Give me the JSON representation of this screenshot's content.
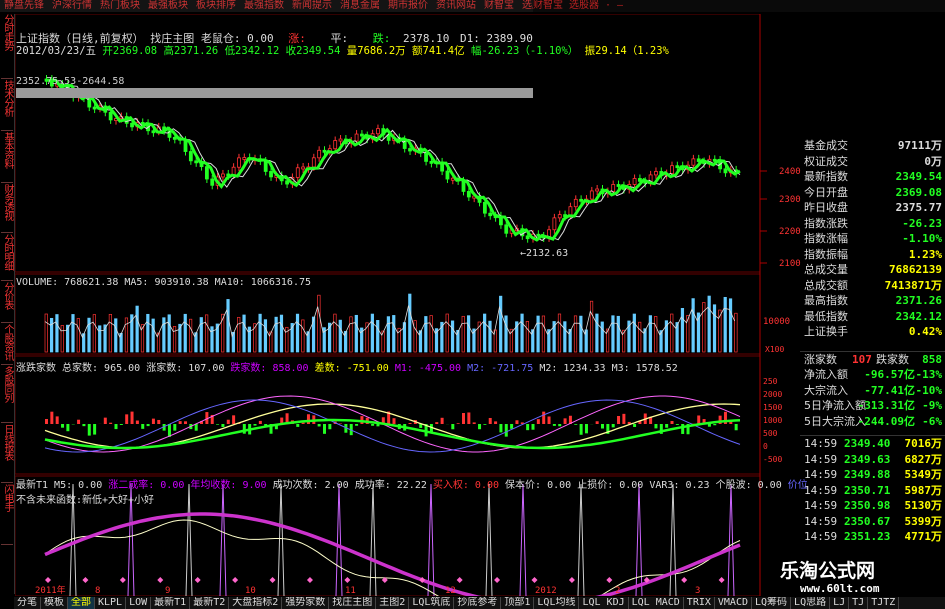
{
  "top_menu": [
    "静盘先锋",
    "沪深行情",
    "热门板块",
    "最强板块",
    "板块排序",
    "最强指数",
    "新闻提示",
    "消息金属",
    "期市报价",
    "资讯网站",
    "财智宝",
    "选股器"
  ],
  "top_menu_tail": [
    "财智宝",
    "选股器",
    "·",
    "—"
  ],
  "left_nav": [
    "分时走势",
    "技术分析",
    "基本资料",
    "财务透视",
    "分时明细",
    "分价表",
    "个股资讯",
    "多股同列",
    "日线报表",
    "闪电手"
  ],
  "info": {
    "title": "上证指数（日线,前复权）  找庄主图  老鼠仓: 0.00",
    "up": "涨:",
    "flat": "平:",
    "down": "跌:",
    "d1_label": "D1:",
    "level1": "2378.10",
    "level2": "2389.90",
    "date": "2012/03/23/五",
    "open": "开2369.08",
    "high": "高2371.26",
    "low": "低2342.12",
    "close": "收2349.54",
    "vol": "量7686.2万",
    "amount": "额741.4亿",
    "change": "幅-26.23（-1.10%）",
    "amp": "振29.14（1.23%"
  },
  "chart_tip": "2352.75.53-2644.58",
  "price_axis": [
    "2400",
    "2300",
    "2200",
    "2100"
  ],
  "min_label": "←2132.63",
  "vol_panel": {
    "title": "VOLUME: 768621.38 MA5: 903910.38 MA10: 1066316.75",
    "axis": [
      "10000"
    ],
    "unit": "X100"
  },
  "breadth_panel": {
    "title_parts": [
      "涨跌家数 总家数: 965.00",
      "涨家数: 107.00",
      "跌家数: 858.00",
      "差数: -751.00",
      "M1: -475.00",
      "M2: -721.75",
      "M2: 1234.33",
      "M3: 1578.52"
    ],
    "axis": [
      "250",
      "2000",
      "1500",
      "1000",
      "500",
      "0",
      "-500"
    ]
  },
  "bottom_panel": {
    "title_parts": [
      "最新T1 M5: 0.00",
      "涨二成率: 0.00",
      "年均收数: 9.00",
      "成功次数: 2.00",
      "成功率: 22.22",
      "买入权: 0.00",
      "保本价: 0.00",
      "止损价: 0.00",
      "VAR3: 0.23",
      "个股波: 0.00",
      "价位"
    ],
    "subtitle": "不含未来函数:新低+大好+小好"
  },
  "right_panel": {
    "rows": [
      {
        "k": "基金成交",
        "v": "97111万",
        "c": "#ddd"
      },
      {
        "k": "权证成交",
        "v": "0万",
        "c": "#ddd"
      },
      {
        "k": "最新指数",
        "v": "2349.54",
        "c": "#2f2"
      },
      {
        "k": "今日开盘",
        "v": "2369.08",
        "c": "#2f2"
      },
      {
        "k": "昨日收盘",
        "v": "2375.77",
        "c": "#ddd"
      },
      {
        "k": "指数涨跌",
        "v": "-26.23",
        "c": "#2f2"
      },
      {
        "k": "指数涨幅",
        "v": "-1.10%",
        "c": "#2f2"
      },
      {
        "k": "指数振幅",
        "v": "1.23%",
        "c": "#ff0"
      },
      {
        "k": "总成交量",
        "v": "76862139",
        "c": "#ff0"
      },
      {
        "k": "总成交额",
        "v": "7413871万",
        "c": "#ff0"
      },
      {
        "k": "最高指数",
        "v": "2371.26",
        "c": "#2f2"
      },
      {
        "k": "最低指数",
        "v": "2342.12",
        "c": "#2f2"
      },
      {
        "k": "上证换手",
        "v": "0.42%",
        "c": "#ff0"
      }
    ],
    "updown": {
      "up_label": "涨家数",
      "up": "107",
      "down_label": "跌家数",
      "down": "858"
    },
    "flows": [
      {
        "k": "净流入额",
        "v": "-96.57亿",
        "p": "-13%"
      },
      {
        "k": "大宗流入",
        "v": "-77.41亿",
        "p": "-10%"
      },
      {
        "k": "5日净流入额",
        "v": "-313.31亿",
        "p": "-9%"
      },
      {
        "k": "5日大宗流入",
        "v": "-244.09亿",
        "p": "-6%"
      }
    ],
    "ticks": [
      {
        "t": "14:59",
        "p": "2349.40",
        "v": "7016万"
      },
      {
        "t": "14:59",
        "p": "2349.63",
        "v": "6827万"
      },
      {
        "t": "14:59",
        "p": "2349.88",
        "v": "5349万"
      },
      {
        "t": "14:59",
        "p": "2350.71",
        "v": "5987万"
      },
      {
        "t": "14:59",
        "p": "2350.98",
        "v": "5130万"
      },
      {
        "t": "14:59",
        "p": "2350.67",
        "v": "5399万"
      },
      {
        "t": "14:59",
        "p": "2351.23",
        "v": "4771万"
      }
    ]
  },
  "date_axis": [
    "2011年",
    "8",
    "9",
    "10",
    "11",
    "12",
    "2012",
    "2",
    "3"
  ],
  "bottom_tabs": [
    "分笔",
    "模板",
    "全部",
    "KLPL",
    "LOW",
    "最新T1",
    "最新T2",
    "大盘指标2",
    "强势家数",
    "找庄主图",
    "主图2",
    "LQL筑底",
    "抄底参考",
    "顶部1",
    "LQL均线",
    "LQL KDJ",
    "LQL MACD",
    "TRIX",
    "VMACD",
    "LQ筹码",
    "LQ思路",
    "LJ",
    "TJ",
    "TJTZ"
  ],
  "bottom_tab_active": "全部",
  "watermark": {
    "brand": "乐淘公式网",
    "url": "www.60lt.com"
  }
}
